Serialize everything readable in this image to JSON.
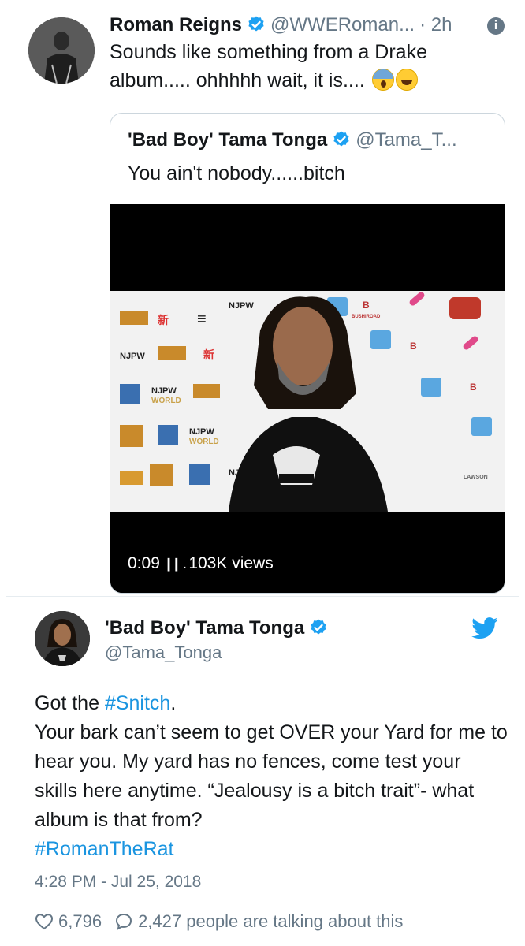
{
  "top_tweet": {
    "name": "Roman Reigns",
    "handle": "@WWERoman...",
    "separator": "·",
    "time": "2h",
    "info_glyph": "i",
    "text": "Sounds like something from a Drake album..... ohhhhh wait, it is....",
    "emojis": [
      "face-screaming-icon",
      "tears-of-joy-icon"
    ]
  },
  "quoted_tweet": {
    "name": "'Bad Boy' Tama Tonga",
    "handle": "@Tama_T...",
    "text": "You ain't nobody......bitch",
    "video": {
      "duration": "0:09",
      "views": "103K views",
      "backdrop_logos": [
        "NJPW",
        "WORLD",
        "BUSHIROAD"
      ]
    }
  },
  "bottom_tweet": {
    "name": "'Bad Boy' Tama Tonga",
    "handle": "@Tama_Tonga",
    "text_line1_prefix": "Got the ",
    "hashtag1": "#Snitch",
    "text_line1_suffix": ".",
    "text_body": "Your bark can’t seem to get OVER your Yard for me to hear you. My yard has no fences, come test your skills here anytime. “Jealousy is a bitch trait”- what album is that from?",
    "hashtag2": "#RomanTheRat",
    "timestamp": "4:28 PM - Jul 25, 2018",
    "likes": "6,796",
    "replies_text": "2,427 people are talking about this"
  },
  "colors": {
    "verified_blue": "#1da1f2",
    "hashtag_blue": "#1b95e0",
    "muted_gray": "#657786",
    "text_dark": "#14171a"
  }
}
